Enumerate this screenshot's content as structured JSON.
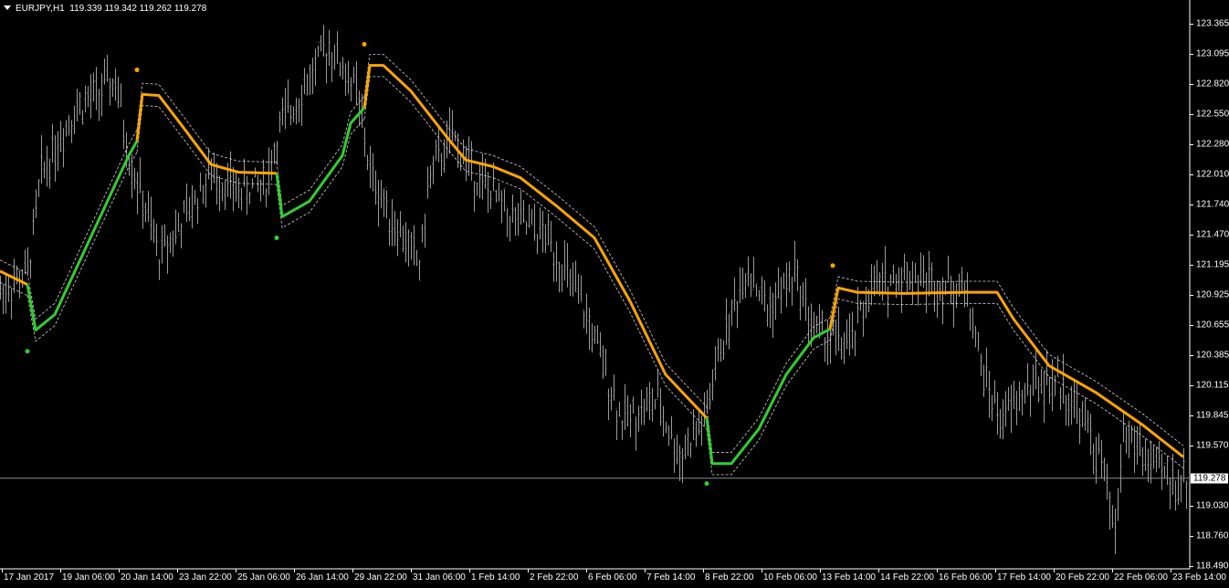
{
  "header": {
    "symbol": "EURJPY,H1",
    "open": "119.339",
    "high": "119.342",
    "low": "119.262",
    "close": "119.278"
  },
  "chart_data": {
    "type": "line",
    "title": "EURJPY,H1",
    "ylim": [
      118.49,
      123.365
    ],
    "y_ticks": [
      "123.365",
      "123.095",
      "122.820",
      "122.550",
      "122.280",
      "122.010",
      "121.740",
      "121.470",
      "121.195",
      "120.925",
      "120.655",
      "120.385",
      "120.115",
      "119.845",
      "119.570",
      "119.030",
      "118.760",
      "118.490"
    ],
    "x_ticks": [
      "17 Jan 2017",
      "19 Jan 06:00",
      "20 Jan 14:00",
      "23 Jan 22:00",
      "25 Jan 06:00",
      "26 Jan 14:00",
      "29 Jan 22:00",
      "31 Jan 06:00",
      "1 Feb 14:00",
      "2 Feb 22:00",
      "6 Feb 06:00",
      "7 Feb 14:00",
      "8 Feb 22:00",
      "10 Feb 06:00",
      "13 Feb 14:00",
      "14 Feb 22:00",
      "16 Feb 06:00",
      "17 Feb 14:00",
      "20 Feb 22:00",
      "22 Feb 06:00",
      "23 Feb 14:00"
    ],
    "current_price": "119.278",
    "price_path": [
      [
        0,
        120.95
      ],
      [
        10,
        121.12
      ],
      [
        15,
        122.02
      ],
      [
        27,
        122.59
      ],
      [
        42,
        122.84
      ],
      [
        47,
        122.18
      ],
      [
        58,
        121.28
      ],
      [
        67,
        121.61
      ],
      [
        77,
        122.02
      ],
      [
        87,
        121.85
      ],
      [
        97,
        121.94
      ],
      [
        102,
        122.43
      ],
      [
        110,
        122.76
      ],
      [
        120,
        123.17
      ],
      [
        130,
        122.76
      ],
      [
        135,
        122.02
      ],
      [
        143,
        121.61
      ],
      [
        153,
        121.2
      ],
      [
        157,
        122.02
      ],
      [
        165,
        122.35
      ],
      [
        173,
        122.02
      ],
      [
        187,
        121.61
      ],
      [
        200,
        121.44
      ],
      [
        213,
        120.79
      ],
      [
        227,
        119.8
      ],
      [
        240,
        119.97
      ],
      [
        248,
        119.47
      ],
      [
        257,
        119.8
      ],
      [
        263,
        120.46
      ],
      [
        273,
        121.2
      ],
      [
        280,
        120.79
      ],
      [
        290,
        121.12
      ],
      [
        297,
        120.62
      ],
      [
        310,
        120.46
      ],
      [
        317,
        120.95
      ],
      [
        330,
        121.12
      ],
      [
        353,
        120.95
      ],
      [
        358,
        120.29
      ],
      [
        365,
        119.8
      ],
      [
        377,
        120.13
      ],
      [
        387,
        120.13
      ],
      [
        397,
        119.72
      ],
      [
        403,
        119.31
      ],
      [
        407,
        118.73
      ],
      [
        410,
        119.72
      ],
      [
        420,
        119.39
      ],
      [
        430,
        119.23
      ],
      [
        433,
        119.28
      ]
    ],
    "indicator_segments": [
      {
        "trend": "down",
        "points": [
          [
            0,
            121.14
          ],
          [
            10,
            121.02
          ]
        ]
      },
      {
        "trend": "up",
        "points": [
          [
            10,
            121.02
          ],
          [
            13,
            120.61
          ],
          [
            20,
            120.75
          ],
          [
            33,
            121.44
          ],
          [
            47,
            122.18
          ],
          [
            50,
            122.31
          ]
        ]
      },
      {
        "trend": "down",
        "points": [
          [
            50,
            122.31
          ],
          [
            52,
            122.73
          ],
          [
            58,
            122.72
          ],
          [
            67,
            122.43
          ],
          [
            77,
            122.1
          ],
          [
            87,
            122.03
          ],
          [
            101,
            122.02
          ]
        ]
      },
      {
        "trend": "up",
        "points": [
          [
            101,
            122.02
          ],
          [
            103,
            121.63
          ],
          [
            113,
            121.77
          ],
          [
            125,
            122.18
          ],
          [
            128,
            122.47
          ],
          [
            133,
            122.61
          ]
        ]
      },
      {
        "trend": "down",
        "points": [
          [
            133,
            122.61
          ],
          [
            135,
            122.99
          ],
          [
            140,
            122.99
          ],
          [
            150,
            122.76
          ],
          [
            163,
            122.35
          ],
          [
            170,
            122.14
          ],
          [
            180,
            122.08
          ],
          [
            190,
            121.98
          ],
          [
            203,
            121.73
          ],
          [
            217,
            121.44
          ],
          [
            230,
            120.87
          ],
          [
            243,
            120.21
          ],
          [
            258,
            119.82
          ]
        ]
      },
      {
        "trend": "up",
        "points": [
          [
            258,
            119.82
          ],
          [
            260,
            119.41
          ],
          [
            267,
            119.41
          ],
          [
            277,
            119.72
          ],
          [
            287,
            120.21
          ],
          [
            297,
            120.54
          ],
          [
            303,
            120.62
          ]
        ]
      },
      {
        "trend": "down",
        "points": [
          [
            303,
            120.62
          ],
          [
            306,
            120.99
          ],
          [
            313,
            120.95
          ],
          [
            330,
            120.94
          ],
          [
            353,
            120.95
          ],
          [
            364,
            120.95
          ],
          [
            370,
            120.71
          ],
          [
            383,
            120.29
          ],
          [
            400,
            120.05
          ],
          [
            417,
            119.76
          ],
          [
            432,
            119.47
          ]
        ]
      }
    ],
    "band_offset": 0.1,
    "signals": [
      {
        "trend": "up",
        "x": 10,
        "y": 120.42
      },
      {
        "trend": "down",
        "x": 50,
        "y": 122.95
      },
      {
        "trend": "up",
        "x": 101,
        "y": 121.44
      },
      {
        "trend": "down",
        "x": 133,
        "y": 123.18
      },
      {
        "trend": "up",
        "x": 258,
        "y": 119.23
      },
      {
        "trend": "down",
        "x": 304,
        "y": 121.19
      }
    ],
    "colors": {
      "up": "#32cd32",
      "down": "#ffa500",
      "bars": "#9a9a9a",
      "band": "#d0d0d0",
      "price_line": "#8c8c8c"
    }
  }
}
